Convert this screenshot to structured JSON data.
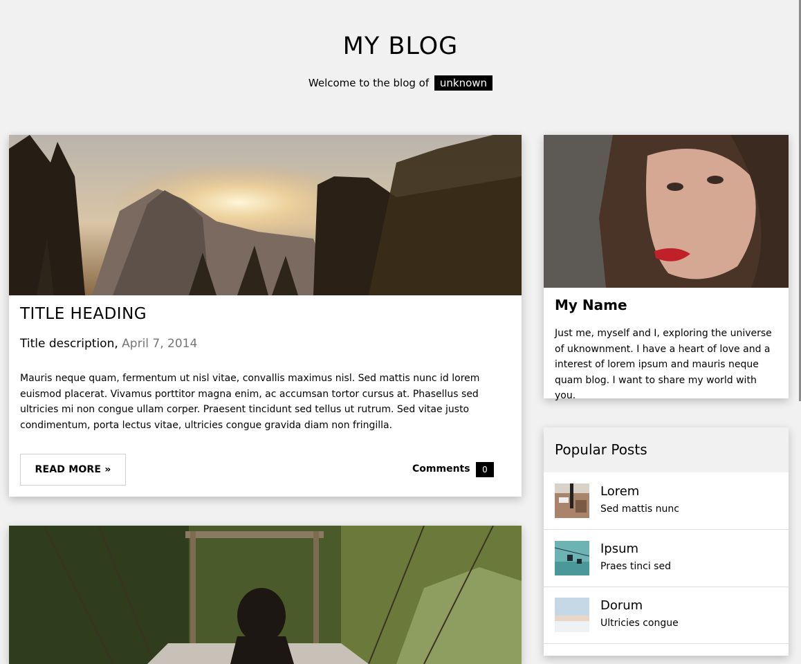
{
  "header": {
    "title": "MY BLOG",
    "welcome_text": "Welcome to the blog of",
    "owner_tag": "unknown"
  },
  "posts": [
    {
      "title": "TITLE HEADING",
      "description": "Title description,",
      "date": "April 7, 2014",
      "body": "Mauris neque quam, fermentum ut nisl vitae, convallis maximus nisl. Sed mattis nunc id lorem euismod placerat. Vivamus porttitor magna enim, ac accumsan tortor cursus at. Phasellus sed ultricies mi non congue ullam corper. Praesent tincidunt sed tellus ut rutrum. Sed vitae justo condimentum, porta lectus vitae, ultricies congue gravida diam non fringilla.",
      "read_more_label": "READ MORE »",
      "comments_label": "Comments",
      "comments_count": "0"
    }
  ],
  "profile": {
    "name": "My Name",
    "bio": "Just me, myself and I, exploring the universe of uknownment. I have a heart of love and a interest of lorem ipsum and mauris neque quam blog. I want to share my world with you."
  },
  "popular": {
    "title": "Popular Posts",
    "items": [
      {
        "title": "Lorem",
        "subtitle": "Sed mattis nunc"
      },
      {
        "title": "Ipsum",
        "subtitle": "Praes tinci sed"
      },
      {
        "title": "Dorum",
        "subtitle": "Ultricies congue"
      }
    ]
  },
  "colors": {
    "background": "#f1f1f1",
    "tag_bg": "#000000",
    "date_gray": "#757575"
  }
}
